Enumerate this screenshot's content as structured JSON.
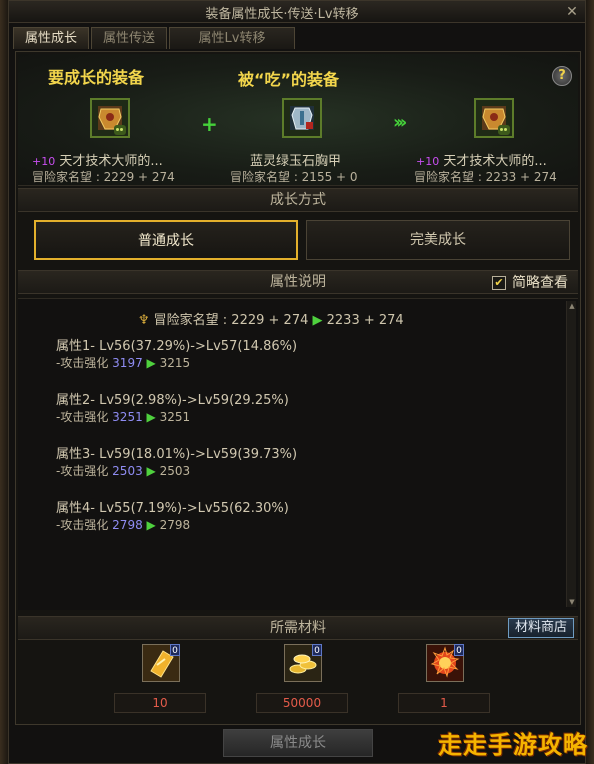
{
  "window": {
    "title": "装备属性成长·传送·Lv转移",
    "close": "✕"
  },
  "tabs": [
    {
      "label": "属性成长",
      "active": true
    },
    {
      "label": "属性传送",
      "active": false
    },
    {
      "label": "属性Lv转移",
      "active": false
    }
  ],
  "header": {
    "left": "要成长的装备",
    "middle": "被“吃”的装备",
    "help": "?"
  },
  "items": [
    {
      "plus": "+10",
      "name": "天才技术大师的...",
      "fame": "冒险家名望 : 2229 + 274"
    },
    {
      "plus": "",
      "name": "蓝灵绿玉石胸甲",
      "fame": "冒险家名望 : 2155 + 0"
    },
    {
      "plus": "+10",
      "name": "天才技术大师的...",
      "fame": "冒险家名望 : 2233 + 274"
    }
  ],
  "growth_mode": {
    "title": "成长方式",
    "normal": "普通成长",
    "perfect": "完美成长"
  },
  "attr_desc": {
    "title": "属性说明",
    "simple_view": "简略查看",
    "checked": true
  },
  "fame_summary": {
    "label": "冒险家名望 : 2229 + 274",
    "arrow": "▶",
    "after": "2233 + 274"
  },
  "attributes": [
    {
      "head": "属性1- Lv56(37.29%)->Lv57(14.86%)",
      "sub": "-攻击强化",
      "before": "3197",
      "after": "3215"
    },
    {
      "head": "属性2- Lv59(2.98%)->Lv59(29.25%)",
      "sub": "-攻击强化",
      "before": "3251",
      "after": "3251"
    },
    {
      "head": "属性3- Lv59(18.01%)->Lv59(39.73%)",
      "sub": "-攻击强化",
      "before": "2503",
      "after": "2503"
    },
    {
      "head": "属性4- Lv55(7.19%)->Lv55(62.30%)",
      "sub": "-攻击强化",
      "before": "2798",
      "after": "2798"
    }
  ],
  "materials": {
    "title": "所需材料",
    "shop": "材料商店",
    "list": [
      {
        "icon": "gold-card-icon",
        "count": "0",
        "qty": "10"
      },
      {
        "icon": "gold-coins-icon",
        "count": "0",
        "qty": "50000"
      },
      {
        "icon": "fire-orb-icon",
        "count": "0",
        "qty": "1"
      }
    ]
  },
  "bottom_button": "属性成长",
  "watermark": "走走手游攻略"
}
